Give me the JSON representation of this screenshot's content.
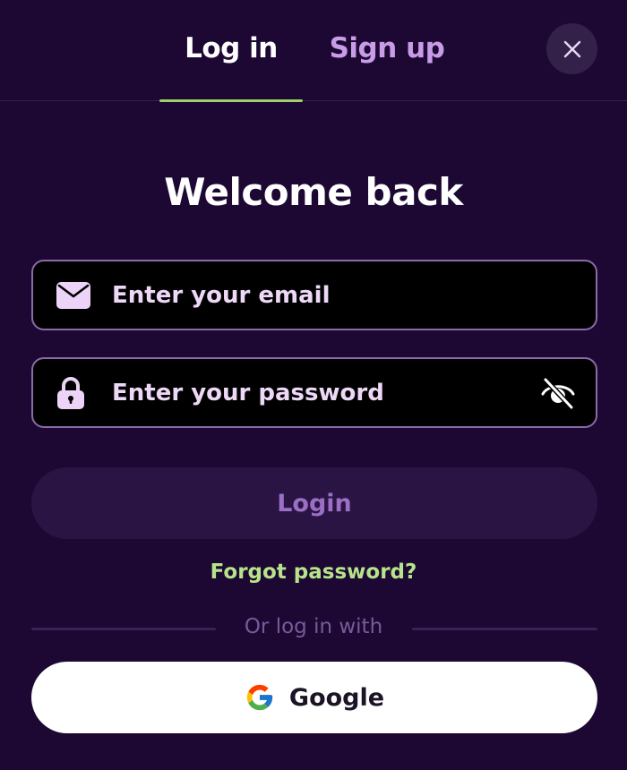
{
  "tabs": {
    "login": "Log in",
    "signup": "Sign up"
  },
  "heading": "Welcome back",
  "form": {
    "email": {
      "placeholder": "Enter your email",
      "value": ""
    },
    "password": {
      "placeholder": "Enter your password",
      "value": ""
    }
  },
  "login_button": "Login",
  "forgot_link": "Forgot password?",
  "divider_text": "Or log in with",
  "google_button": "Google",
  "icons": {
    "close": "close-icon",
    "email": "envelope-icon",
    "password": "lock-icon",
    "toggle": "eye-off-icon",
    "google": "google-icon"
  },
  "colors": {
    "background": "#1c0833",
    "active_tab_underline": "#9fd16b",
    "inactive_tab": "#c89ce6",
    "field_border": "#8a6aa8",
    "login_button_bg": "#2a1444",
    "login_button_text": "#9a6fc4",
    "forgot_link": "#b7e38a"
  }
}
